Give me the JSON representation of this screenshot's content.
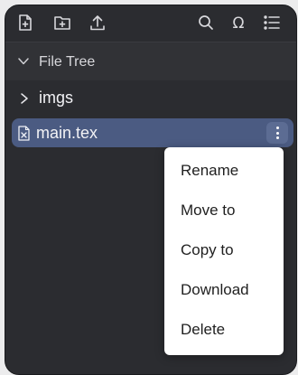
{
  "toolbar": {
    "icons": [
      "new-file-icon",
      "new-folder-icon",
      "upload-icon",
      "search-icon",
      "omega-symbol-icon",
      "list-outline-icon"
    ]
  },
  "file_tree": {
    "header_label": "File Tree",
    "items": [
      {
        "label": "imgs",
        "type": "folder",
        "expanded": false
      },
      {
        "label": "main.tex",
        "type": "file",
        "selected": true
      }
    ]
  },
  "context_menu": {
    "items": [
      "Rename",
      "Move to",
      "Copy to",
      "Download",
      "Delete"
    ]
  },
  "colors": {
    "panel_bg": "#2b2c30",
    "selected_row": "#4b5b82",
    "menu_bg": "#ffffff"
  }
}
